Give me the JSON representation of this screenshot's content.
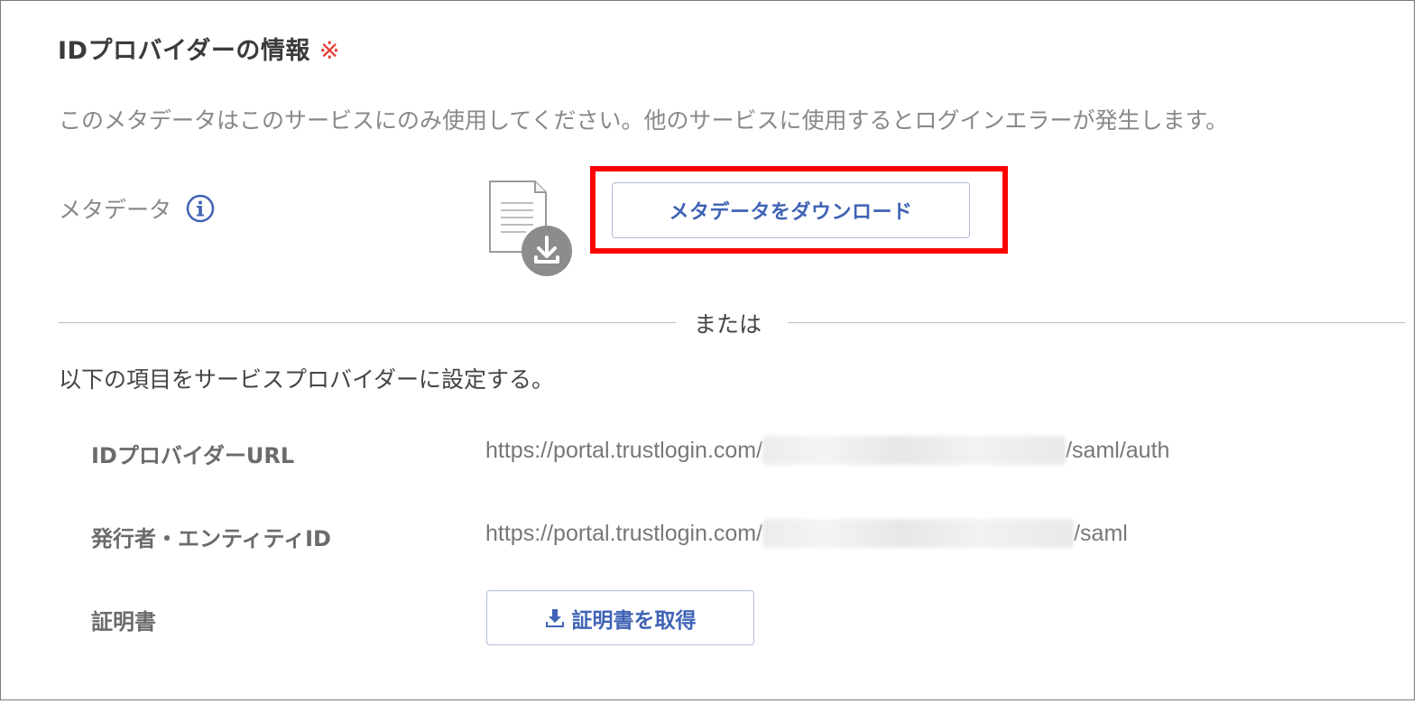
{
  "section": {
    "title": "IDプロバイダーの情報",
    "required_mark": "※"
  },
  "notice": "このメタデータはこのサービスにのみ使用してください。他のサービスに使用するとログインエラーが発生します。",
  "metadata": {
    "label": "メタデータ",
    "info_icon": "info-circle-icon",
    "file_icon": "document-download-icon",
    "download_button_label": "メタデータをダウンロード"
  },
  "divider": {
    "text": "または"
  },
  "instructions": "以下の項目をサービスプロバイダーに設定する。",
  "fields": {
    "idp_url": {
      "label": "IDプロバイダーURL",
      "value_prefix": "https://portal.trustlogin.com/",
      "value_suffix": "/saml/auth"
    },
    "entity_id": {
      "label": "発行者・エンティティID",
      "value_prefix": "https://portal.trustlogin.com/",
      "value_suffix": "/saml"
    },
    "certificate": {
      "label": "証明書",
      "button_label": "証明書を取得",
      "button_icon": "download-icon"
    }
  },
  "colors": {
    "accent": "#3f63b5",
    "highlight": "#ff0000",
    "required": "#e53935"
  }
}
